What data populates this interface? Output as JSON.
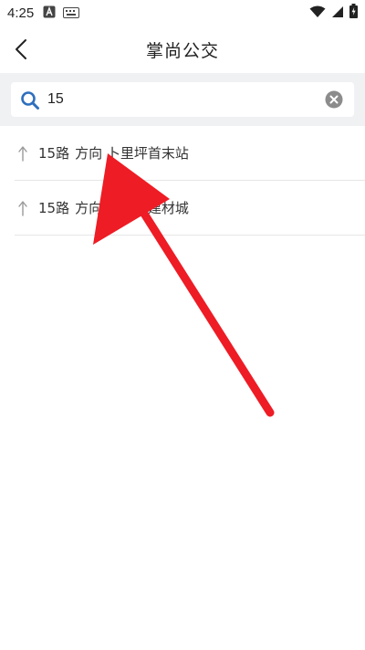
{
  "status_bar": {
    "time": "4:25",
    "icons_left": [
      "app-a-icon",
      "keyboard-icon"
    ],
    "icons_right": [
      "wifi-icon",
      "signal-icon",
      "battery-charging-icon"
    ]
  },
  "app_bar": {
    "title": "掌尚公交",
    "back_icon": "chevron-left-icon"
  },
  "search": {
    "value": "15",
    "placeholder": ""
  },
  "results": [
    {
      "route": "15路",
      "direction_label": "方向",
      "destination": "卜里坪首末站"
    },
    {
      "route": "15路",
      "direction_label": "方向",
      "destination": "大屯电建材城"
    }
  ],
  "colors": {
    "search_icon": "#2f6fbd",
    "annotation_arrow": "#ee1c25",
    "search_bg": "#f0f1f3"
  }
}
